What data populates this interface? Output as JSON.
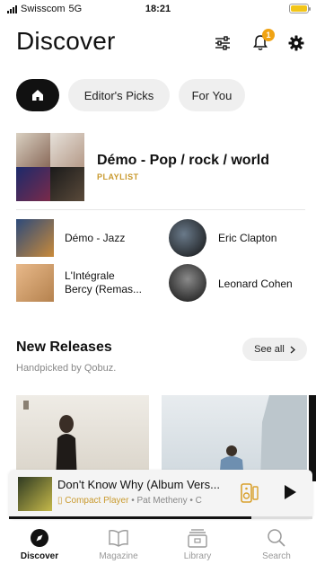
{
  "status_bar": {
    "carrier": "Swisscom",
    "network": "5G",
    "time": "18:21"
  },
  "header": {
    "title": "Discover",
    "notification_count": "1"
  },
  "chips": [
    {
      "label": "Editor's Picks"
    },
    {
      "label": "For You"
    }
  ],
  "featured": {
    "title": "Démo - Pop / rock / world",
    "type": "PLAYLIST"
  },
  "grid": [
    {
      "label_line1": "Démo - Jazz",
      "label_line2": ""
    },
    {
      "label_line1": "Eric Clapton",
      "label_line2": ""
    },
    {
      "label_line1": "L'Intégrale",
      "label_line2": "Bercy (Remas..."
    },
    {
      "label_line1": "Leonard Cohen",
      "label_line2": ""
    }
  ],
  "new_releases": {
    "title": "New Releases",
    "subtitle": "Handpicked by Qobuz.",
    "see_all": "See all"
  },
  "player": {
    "title": "Don't Know Why (Album Vers...",
    "device": "Compact Player",
    "artist_line": " • Pat Metheny • C",
    "progress": 0.8
  },
  "tabs": [
    {
      "label": "Discover",
      "icon": "compass-icon",
      "active": true
    },
    {
      "label": "Magazine",
      "icon": "book-icon",
      "active": false
    },
    {
      "label": "Library",
      "icon": "library-icon",
      "active": false
    },
    {
      "label": "Search",
      "icon": "search-icon",
      "active": false
    }
  ],
  "colors": {
    "accent": "#c99a2e",
    "badge": "#f0a313",
    "battery": "#f2c518"
  }
}
